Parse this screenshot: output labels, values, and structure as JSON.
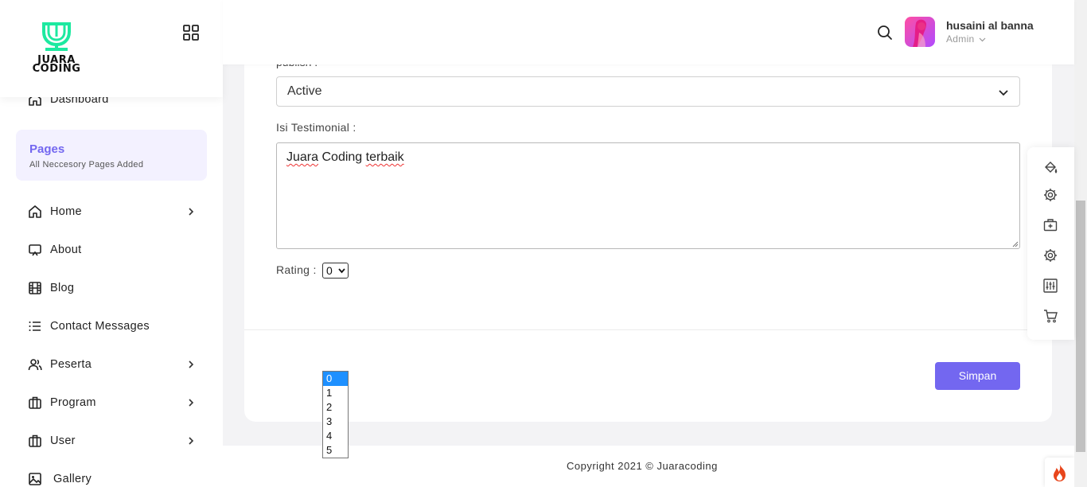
{
  "brand": {
    "logo_line1": "JUARA",
    "logo_line2": "CODING",
    "logo_color": "#1de9a0"
  },
  "header": {
    "user_name": "husaini al banna",
    "user_role": "Admin"
  },
  "sidebar": {
    "dashboard": "Dashboard",
    "pages_title": "Pages",
    "pages_subtitle": "All Neccesory Pages Added",
    "items": [
      {
        "label": "Home",
        "icon": "home-icon",
        "has_children": true
      },
      {
        "label": "About",
        "icon": "monitor-icon",
        "has_children": false
      },
      {
        "label": "Blog",
        "icon": "film-icon",
        "has_children": false
      },
      {
        "label": "Contact Messages",
        "icon": "list-icon",
        "has_children": false
      },
      {
        "label": "Peserta",
        "icon": "users-icon",
        "has_children": true
      },
      {
        "label": "Program",
        "icon": "briefcase-icon",
        "has_children": true
      },
      {
        "label": "User",
        "icon": "briefcase-icon",
        "has_children": true
      },
      {
        "label": "Gallery",
        "icon": "image-icon",
        "has_children": false
      }
    ]
  },
  "form": {
    "cut_label": "publish :",
    "status_value": "Active",
    "testimonial_label": "Isi Testimonial :",
    "testimonial_word1": "Juara",
    "testimonial_word2": "Coding",
    "testimonial_word3": "terbaik",
    "rating_label": "Rating :",
    "rating_value": "0",
    "rating_options": [
      "0",
      "1",
      "2",
      "3",
      "4",
      "5"
    ],
    "submit_label": "Simpan"
  },
  "footer": {
    "copyright": "Copyright 2021 © Juaracoding"
  },
  "colors": {
    "accent": "#7367f0",
    "dropdown_highlight": "#1e90ff"
  }
}
